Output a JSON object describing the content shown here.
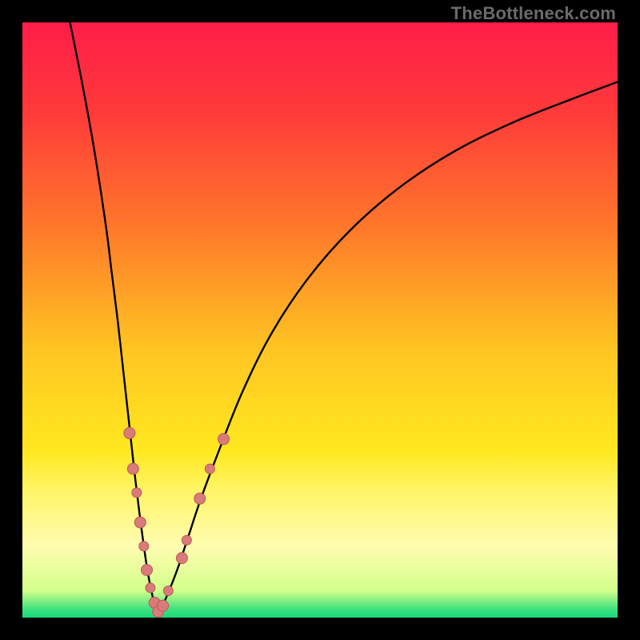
{
  "watermark": "TheBottleneck.com",
  "chart_data": {
    "type": "line",
    "title": "",
    "xlabel": "",
    "ylabel": "",
    "xlim": [
      0,
      100
    ],
    "ylim": [
      0,
      100
    ],
    "gradient_stops": [
      {
        "offset": 0.0,
        "color": "#ff1d49"
      },
      {
        "offset": 0.15,
        "color": "#ff3a3a"
      },
      {
        "offset": 0.35,
        "color": "#ff7a2a"
      },
      {
        "offset": 0.55,
        "color": "#ffc522"
      },
      {
        "offset": 0.72,
        "color": "#ffe81f"
      },
      {
        "offset": 0.79,
        "color": "#fff56a"
      },
      {
        "offset": 0.88,
        "color": "#fffcb0"
      },
      {
        "offset": 0.955,
        "color": "#d2ff8a"
      },
      {
        "offset": 0.985,
        "color": "#41e27f"
      },
      {
        "offset": 1.0,
        "color": "#17d87b"
      }
    ],
    "series": [
      {
        "name": "curve-left",
        "x": [
          8,
          10,
          12,
          14,
          15,
          16,
          17,
          18,
          19,
          20,
          21,
          22,
          22.8
        ],
        "y": [
          100,
          90,
          79,
          66,
          58,
          50,
          41,
          32,
          23,
          15,
          8,
          3,
          0.5
        ]
      },
      {
        "name": "curve-right",
        "x": [
          22.8,
          24,
          26,
          28,
          30,
          33,
          37,
          42,
          48,
          55,
          63,
          72,
          82,
          92,
          100
        ],
        "y": [
          0.5,
          3,
          8,
          14,
          20,
          28,
          38,
          48,
          57,
          65,
          72,
          78,
          83,
          87,
          90
        ]
      }
    ],
    "markers": {
      "color": "#d97b79",
      "stroke": "#bb5a58",
      "points": [
        {
          "x": 18.0,
          "y": 31,
          "r": 7
        },
        {
          "x": 18.6,
          "y": 25,
          "r": 7
        },
        {
          "x": 19.2,
          "y": 21,
          "r": 6
        },
        {
          "x": 19.8,
          "y": 16,
          "r": 7
        },
        {
          "x": 20.4,
          "y": 12,
          "r": 6
        },
        {
          "x": 20.9,
          "y": 8,
          "r": 7
        },
        {
          "x": 21.5,
          "y": 5,
          "r": 6
        },
        {
          "x": 22.2,
          "y": 2.5,
          "r": 7
        },
        {
          "x": 22.8,
          "y": 1.0,
          "r": 7
        },
        {
          "x": 23.6,
          "y": 2.0,
          "r": 7
        },
        {
          "x": 24.5,
          "y": 4.5,
          "r": 6
        },
        {
          "x": 26.8,
          "y": 10,
          "r": 7
        },
        {
          "x": 27.6,
          "y": 13,
          "r": 6
        },
        {
          "x": 29.8,
          "y": 20,
          "r": 7
        },
        {
          "x": 31.5,
          "y": 25,
          "r": 6
        },
        {
          "x": 33.8,
          "y": 30,
          "r": 7
        }
      ]
    }
  }
}
